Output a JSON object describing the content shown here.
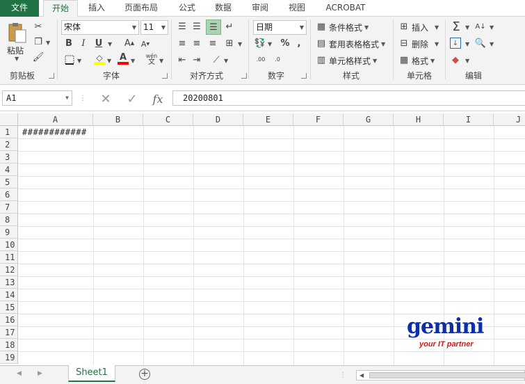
{
  "tabs": [
    "文件",
    "开始",
    "插入",
    "页面布局",
    "公式",
    "数据",
    "审阅",
    "视图",
    "ACROBAT"
  ],
  "clipboard": {
    "paste_label": "粘贴",
    "group_label": "剪贴板"
  },
  "font": {
    "name": "宋体",
    "size": "11",
    "group_label": "字体",
    "phonetic": "wén"
  },
  "alignment": {
    "group_label": "对齐方式"
  },
  "number": {
    "format": "日期",
    "group_label": "数字"
  },
  "styles": {
    "conditional": "条件格式",
    "table": "套用表格格式",
    "cell": "单元格样式",
    "group_label": "样式"
  },
  "cells": {
    "insert": "插入",
    "delete": "删除",
    "format": "格式",
    "group_label": "单元格"
  },
  "editing": {
    "group_label": "编辑"
  },
  "formula_bar": {
    "name_box": "A1",
    "fx": "fx",
    "content": "20200801"
  },
  "columns": [
    "A",
    "B",
    "C",
    "D",
    "E",
    "F",
    "G",
    "H",
    "I",
    "J"
  ],
  "rows": [
    "1",
    "2",
    "3",
    "4",
    "5",
    "6",
    "7",
    "8",
    "9",
    "10",
    "11",
    "12",
    "13",
    "14",
    "15",
    "16",
    "17",
    "18",
    "19"
  ],
  "cell_a1": "############",
  "sheet": {
    "name": "Sheet1"
  },
  "logo": {
    "brand": "gemini",
    "tagline": "your IT partner"
  },
  "colors": {
    "accent": "#217346",
    "highlight": "#ffff00",
    "font_color": "#ff0000",
    "logo": "#0a2fa8"
  }
}
